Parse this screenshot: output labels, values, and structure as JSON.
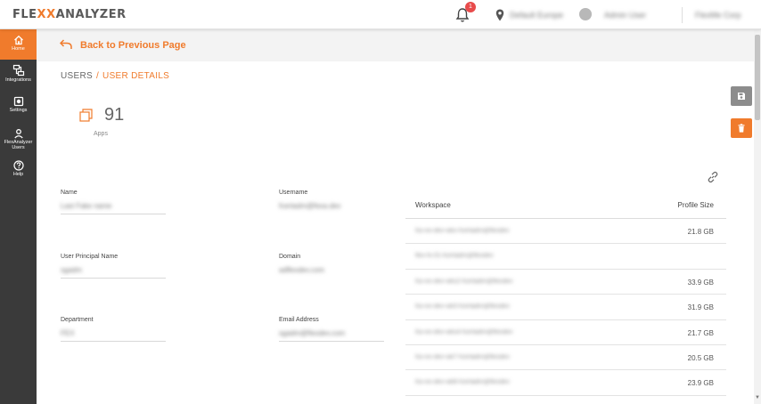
{
  "header": {
    "logo": {
      "flex": "FLE",
      "xx": "XX",
      "analyzer": "ANALYZER"
    },
    "notification_count": "1",
    "location_text": "Default Europe",
    "user_text": "Admin User",
    "extra_text": "FlexMe Corp"
  },
  "sidebar": {
    "items": [
      {
        "label": "Home",
        "icon": "home-icon",
        "active": true
      },
      {
        "label": "Integrations",
        "icon": "integrations-icon",
        "active": false
      },
      {
        "label": "Settings",
        "icon": "settings-icon",
        "active": false
      },
      {
        "label": "FlexAnalyzer Users",
        "icon": "user-icon",
        "active": false
      },
      {
        "label": "Help",
        "icon": "help-icon",
        "active": false
      }
    ]
  },
  "back": {
    "label": "Back to Previous Page"
  },
  "breadcrumb": {
    "root": "USERS",
    "separator": "/",
    "current": "USER DETAILS"
  },
  "apps": {
    "count": "91",
    "label": "Apps"
  },
  "fields": {
    "name": {
      "label": "Name",
      "value": "Last Fake name"
    },
    "username": {
      "label": "Username",
      "value": "fcertadm@fexa.dev"
    },
    "upn": {
      "label": "User Principal Name",
      "value": "sgadm"
    },
    "domain": {
      "label": "Domain",
      "value": "adflexdev.com"
    },
    "department": {
      "label": "Department",
      "value": "FEX"
    },
    "email": {
      "label": "Email Address",
      "value": "sgadm@flexdev.com"
    }
  },
  "workspace": {
    "col_workspace": "Workspace",
    "col_profile_size": "Profile Size",
    "rows": [
      {
        "workspace": "fsx-ex-dev-wks-fcertadm@flexdev",
        "size": "21.8 GB"
      },
      {
        "workspace": "flex-fs-01-fcertadm@flexdev",
        "size": ""
      },
      {
        "workspace": "fsx-ex-dev-wks2-fcertadm@flexdev",
        "size": "33.9 GB"
      },
      {
        "workspace": "fsx-ex-dev-wk3-fcertadm@flexdev",
        "size": "31.9 GB"
      },
      {
        "workspace": "fsx-ex-dev-wks4-fcertadm@flexdev",
        "size": "21.7 GB"
      },
      {
        "workspace": "fsx-ex-dev-wk7-fcertadm@flexdev",
        "size": "20.5 GB"
      },
      {
        "workspace": "fsx-ex-dev-wk8-fcertadm@flexdev",
        "size": "23.9 GB"
      }
    ]
  },
  "colors": {
    "accent": "#f07b2c",
    "sidebar_bg": "#3a3a3a",
    "save_button": "#8c8c8c",
    "badge": "#e84b4b"
  }
}
